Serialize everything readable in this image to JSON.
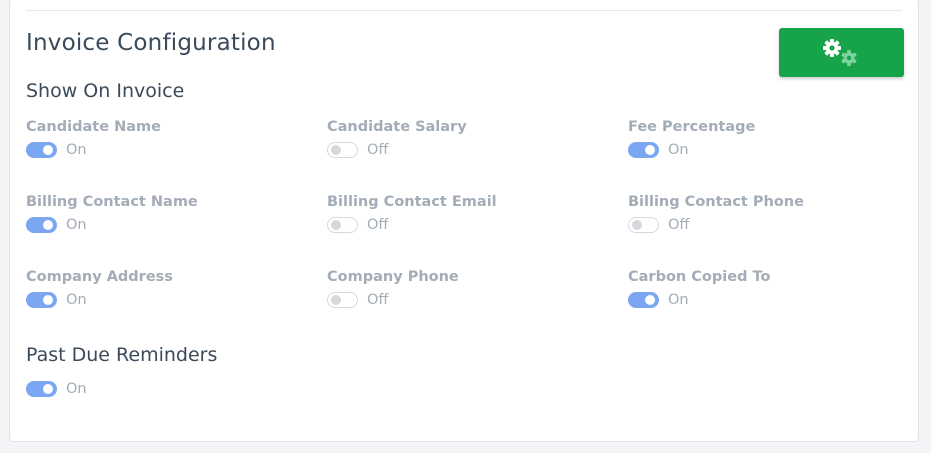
{
  "header": {
    "title": "Invoice Configuration",
    "settings_icon": "gears-icon",
    "button_color": "#16a34a"
  },
  "show_on_invoice": {
    "title": "Show On Invoice",
    "fields": [
      {
        "label": "Candidate Name",
        "state": "On"
      },
      {
        "label": "Candidate Salary",
        "state": "Off"
      },
      {
        "label": "Fee Percentage",
        "state": "On"
      },
      {
        "label": "Billing Contact Name",
        "state": "On"
      },
      {
        "label": "Billing Contact Email",
        "state": "Off"
      },
      {
        "label": "Billing Contact Phone",
        "state": "Off"
      },
      {
        "label": "Company Address",
        "state": "On"
      },
      {
        "label": "Company Phone",
        "state": "Off"
      },
      {
        "label": "Carbon Copied To",
        "state": "On"
      }
    ]
  },
  "past_due": {
    "title": "Past Due Reminders",
    "state": "On"
  },
  "colors": {
    "toggle_on": "#7ba6f2",
    "toggle_off": "#d5d9de"
  }
}
